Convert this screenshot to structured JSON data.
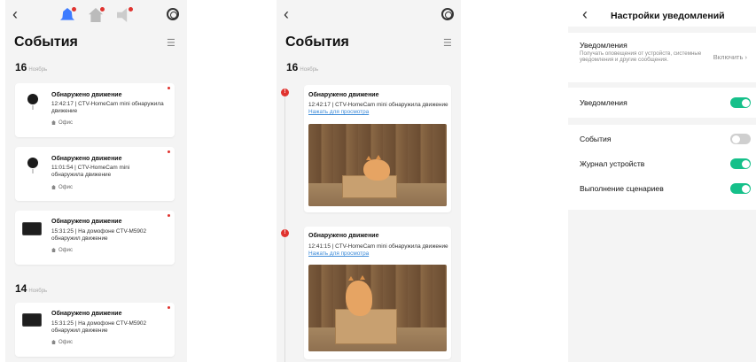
{
  "p1": {
    "title": "События",
    "date16": "16",
    "date16m": "Ноябрь",
    "date14": "14",
    "date14m": "Ноябрь",
    "cards": [
      {
        "t": "Обнаружено движение",
        "s": "12:42:17 |  CTV-HomeCam mini обнаружила движение",
        "l": "Офис"
      },
      {
        "t": "Обнаружено движение",
        "s": "11:01:54 | CTV-HomeCam mini обнаружила движение",
        "l": "Офис"
      },
      {
        "t": "Обнаружено движение",
        "s": "15:31:25 | На домофоне CTV-M5902 обнаружил движение",
        "l": "Офис"
      },
      {
        "t": "Обнаружено движение",
        "s": "15:31:25 | На домофоне CTV-M5902 обнаружил движение",
        "l": "Офис"
      }
    ]
  },
  "p2": {
    "title": "События",
    "date16": "16",
    "date16m": "Ноябрь",
    "cards": [
      {
        "t": "Обнаружено движение",
        "s": "12:42:17 | CTV-HomeCam mini обнаружила движение ",
        "link": "Нажать для просмотра"
      },
      {
        "t": "Обнаружено движение",
        "s": "12:41:15 | CTV-HomeCam mini обнаружила движение ",
        "link": "Нажать для просмотра"
      }
    ]
  },
  "p3": {
    "title": "Настройки уведомлений",
    "notif_title": "Уведомления",
    "notif_sub": "Получать оповещения от устройств, системные уведомления и другие сообщения.",
    "enable": "Включить",
    "notif2": "Уведомления",
    "events": "События",
    "journal": "Журнал устройств",
    "scenarios": "Выполнение сценариев"
  },
  "icons": [
    "back-icon",
    "bell-icon",
    "home-icon",
    "speaker-icon",
    "gear-icon",
    "filter-icon",
    "camera-icon",
    "monitor-icon",
    "alert-icon",
    "location-icon"
  ],
  "colors": {
    "accent": "#16c08a",
    "alert": "#e0332f",
    "link": "#3d8bd8",
    "bell": "#3d7bff"
  },
  "toggles": {
    "notifications": true,
    "events": false,
    "journal": true,
    "scenarios": true
  }
}
